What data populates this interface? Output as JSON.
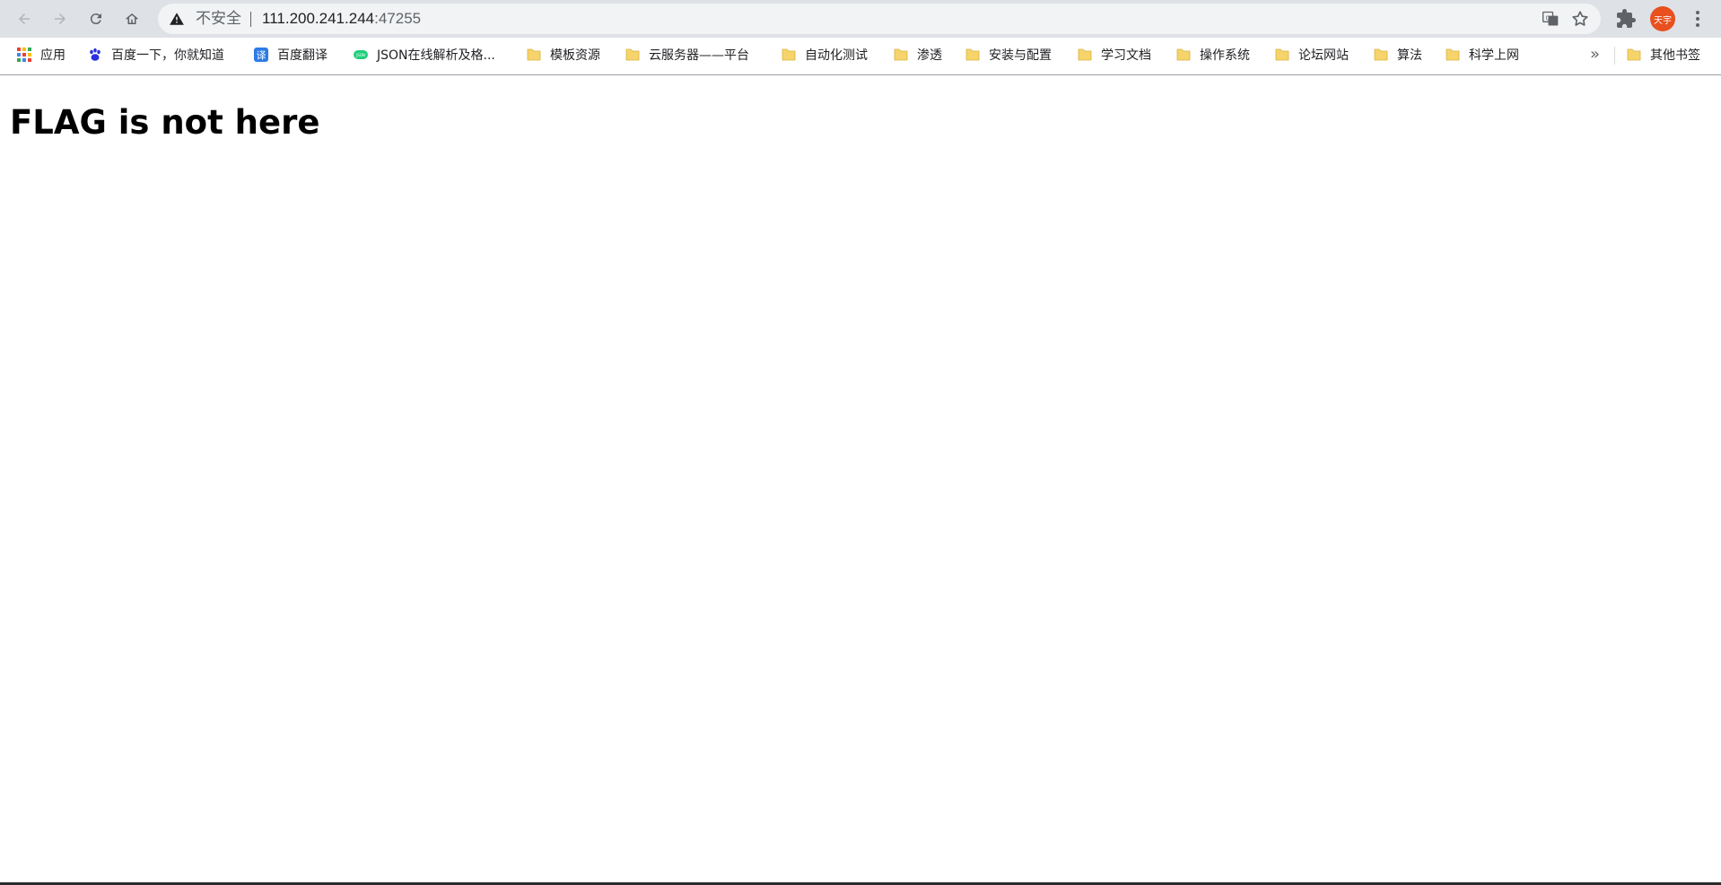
{
  "browser": {
    "address_bar": {
      "security_label": "不安全",
      "host": "111.200.241.244",
      "port": ":47255"
    },
    "profile_avatar_text": "天宇",
    "icons": [
      "back-icon",
      "forward-icon",
      "reload-icon",
      "home-icon",
      "warning-icon",
      "translate-icon",
      "star-icon",
      "puzzle-icon",
      "kebab-menu-icon"
    ]
  },
  "bookmarks": {
    "items": [
      {
        "label": "应用",
        "icon": "apps-grid-icon"
      },
      {
        "label": "百度一下，你就知道",
        "icon": "baidu-paw-icon"
      },
      {
        "label": "百度翻译",
        "icon": "translate-badge-icon"
      },
      {
        "label": "JSON在线解析及格...",
        "icon": "json-icon"
      },
      {
        "label": "模板资源",
        "icon": "folder-icon"
      },
      {
        "label": "云服务器——平台",
        "icon": "folder-icon"
      },
      {
        "label": "自动化测试",
        "icon": "folder-icon"
      },
      {
        "label": "渗透",
        "icon": "folder-icon"
      },
      {
        "label": "安装与配置",
        "icon": "folder-icon"
      },
      {
        "label": "学习文档",
        "icon": "folder-icon"
      },
      {
        "label": "操作系统",
        "icon": "folder-icon"
      },
      {
        "label": "论坛网站",
        "icon": "folder-icon"
      },
      {
        "label": "算法",
        "icon": "folder-icon"
      },
      {
        "label": "科学上网",
        "icon": "folder-icon"
      }
    ],
    "overflow_label": "»",
    "other_bookmarks": "其他书签"
  },
  "page": {
    "heading": "FLAG is not here"
  },
  "colors": {
    "toolbar_bg": "#dee1e6",
    "omnibox_bg": "#f1f3f4",
    "avatar_bg": "#e8501e",
    "folder_yellow": "#f6d46b"
  }
}
